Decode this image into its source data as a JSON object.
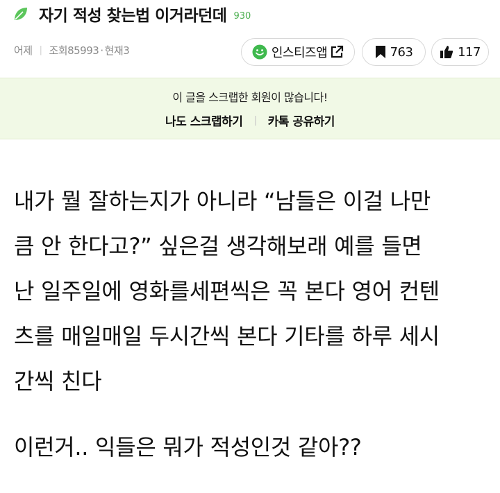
{
  "post": {
    "title": "자기 적성 찾는법 이거라던데",
    "title_count": "930",
    "meta": {
      "date": "어제",
      "views": "조회85993",
      "current": "현재3"
    }
  },
  "actions": {
    "instiz_app_label": "인스티즈앱",
    "bookmark_count": "763",
    "like_count": "117"
  },
  "scrap": {
    "message": "이 글을 스크랩한 회원이 많습니다!",
    "scrap_label": "나도 스크랩하기",
    "kakao_share_label": "카톡 공유하기"
  },
  "content": {
    "lines": [
      "내가 뭘 잘하는지가 아니라 “남들은 이걸 나만",
      "큼 안 한다고?” 싶은걸 생각해보래 예를 들면",
      "난 일주일에 영화를세편씩은 꼭 본다 영어 컨텐",
      "츠를 매일매일 두시간씩 본다 기타를 하루 세시",
      "간씩 친다"
    ],
    "closing": "이런거.. 익들은 뭐가 적성인것 같아??"
  },
  "colors": {
    "accent_green": "#4caf50",
    "scrap_bg": "#f1f9e6"
  },
  "icons": [
    "leaf-icon",
    "smiley-icon",
    "external-link-icon",
    "bookmark-icon",
    "thumbs-up-icon"
  ]
}
